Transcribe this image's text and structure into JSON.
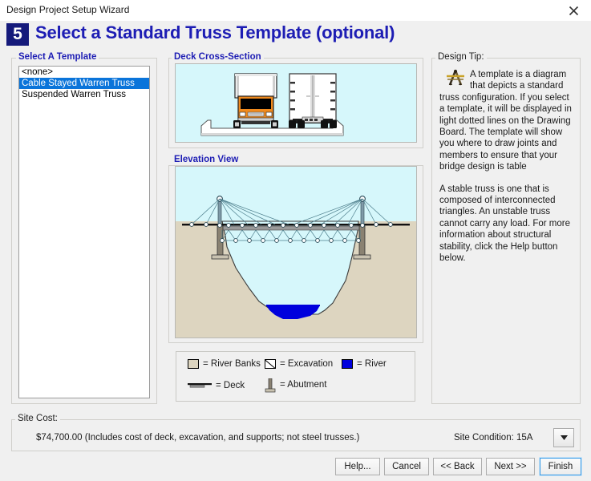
{
  "window": {
    "title": "Design Project Setup Wizard",
    "close_icon": "close-icon"
  },
  "header": {
    "step_number": "5",
    "title": "Select a Standard Truss Template (optional)"
  },
  "template_panel": {
    "label": "Select A Template",
    "items": [
      {
        "label": "<none>",
        "selected": false
      },
      {
        "label": "Cable Stayed Warren Truss",
        "selected": true
      },
      {
        "label": "Suspended Warren Truss",
        "selected": false
      }
    ]
  },
  "deck_panel": {
    "label": "Deck Cross-Section"
  },
  "elevation_panel": {
    "label": "Elevation View"
  },
  "legend": {
    "items": [
      {
        "label": "= River Banks",
        "swatch": "river-banks-swatch",
        "color": "#ddd5c0"
      },
      {
        "label": "= Excavation",
        "swatch": "excavation-swatch",
        "color": "#ffffff"
      },
      {
        "label": "= River",
        "swatch": "river-swatch",
        "color": "#0000dd"
      },
      {
        "label": "= Deck",
        "swatch": "deck-swatch",
        "color": "#000000"
      },
      {
        "label": "= Abutment",
        "swatch": "abutment-swatch",
        "color": "#8a8272"
      }
    ]
  },
  "design_tip": {
    "label": "Design Tip:",
    "icon": "drafting-compass-icon",
    "paragraph1": "A template is a diagram that depicts a standard truss configuration. If you select a template, it will be displayed in light dotted lines on the Drawing Board. The template will show you where to draw joints and members to ensure that your bridge design is table",
    "paragraph2": "A stable truss is one that is composed of interconnected triangles. An unstable truss cannot carry any load. For more information about structural stability, click the Help button below."
  },
  "site_cost": {
    "label": "Site Cost:",
    "value": "$74,700.00  (Includes cost of deck, excavation, and supports; not steel trusses.)",
    "condition_label": "Site Condition: 15A",
    "dropdown_icon": "chevron-down-icon"
  },
  "buttons": {
    "help": "Help...",
    "cancel": "Cancel",
    "back": "<< Back",
    "next": "Next >>",
    "finish": "Finish"
  },
  "colors": {
    "title_blue": "#1d1db4",
    "badge_navy": "#151a7b",
    "selection_blue": "#0a74da",
    "sky": "#d6f7fb",
    "terrain": "#ddd5c0",
    "river": "#0000dd",
    "truck_orange": "#f08a1e",
    "focus_blue": "#3399e6"
  }
}
